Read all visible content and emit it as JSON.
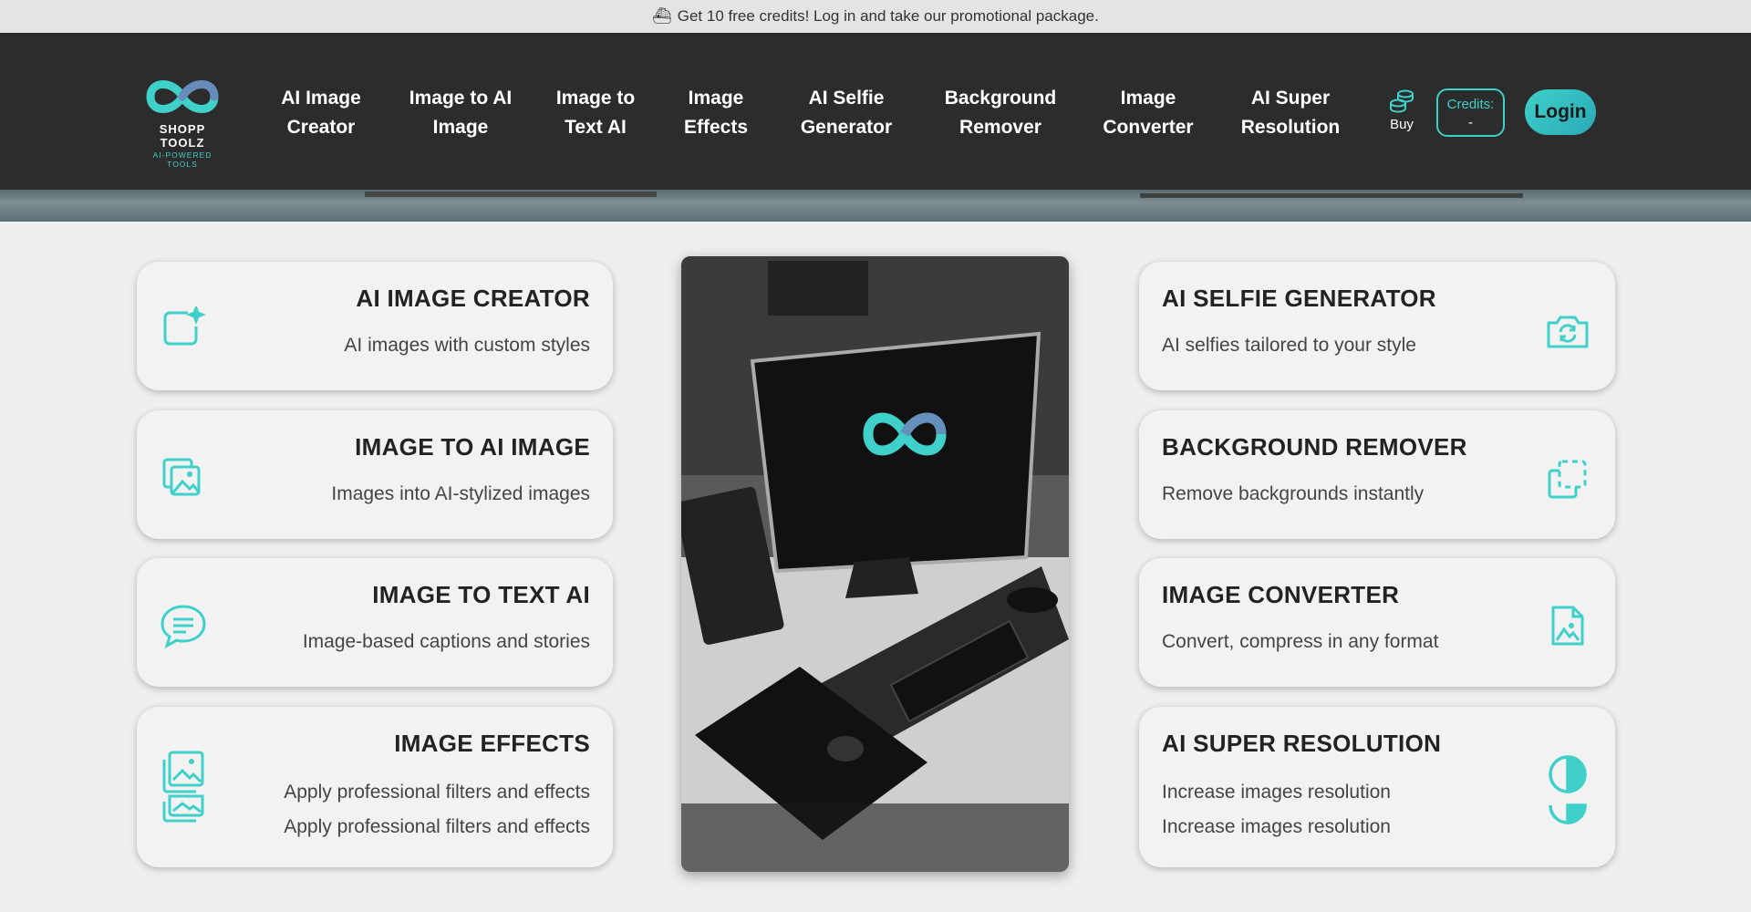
{
  "promo": {
    "icon": "ship-icon",
    "text": "Get 10 free credits! Log in and take our promotional package."
  },
  "logo": {
    "brand": "SHOPP TOOLZ",
    "tagline": "AI-POWERED TOOLS"
  },
  "nav": {
    "items": [
      {
        "line1": "AI Image",
        "line2": "Creator"
      },
      {
        "line1": "Image to AI",
        "line2": "Image"
      },
      {
        "line1": "Image to",
        "line2": "Text AI"
      },
      {
        "line1": "Image",
        "line2": "Effects"
      },
      {
        "line1": "AI Selfie",
        "line2": "Generator"
      },
      {
        "line1": "Background",
        "line2": "Remover"
      },
      {
        "line1": "Image",
        "line2": "Converter"
      },
      {
        "line1": "AI Super",
        "line2": "Resolution"
      }
    ],
    "buy_label": "Buy",
    "credits_label": "Credits:",
    "credits_value": "-",
    "login_label": "Login"
  },
  "cards": {
    "left": [
      {
        "title": "AI IMAGE CREATOR",
        "desc": "AI images with custom styles",
        "icon": "image-sparkle-icon"
      },
      {
        "title": "IMAGE TO AI IMAGE",
        "desc": "Images into AI-stylized images",
        "icon": "photo-stack-icon"
      },
      {
        "title": "IMAGE TO TEXT AI",
        "desc": "Image-based captions and stories",
        "icon": "chat-bubble-icon"
      },
      {
        "title": "IMAGE EFFECTS",
        "desc": "Apply professional filters and effects",
        "desc2": "Apply professional filters and effects",
        "icon": "gallery-icon"
      }
    ],
    "right": [
      {
        "title": "AI SELFIE GENERATOR",
        "desc": "AI selfies tailored to your style",
        "icon": "camera-rotate-icon"
      },
      {
        "title": "BACKGROUND REMOVER",
        "desc": "Remove backgrounds instantly",
        "icon": "copy-dashed-icon"
      },
      {
        "title": "IMAGE CONVERTER",
        "desc": "Convert, compress in any format",
        "icon": "file-image-icon"
      },
      {
        "title": "AI SUPER RESOLUTION",
        "desc": "Increase images resolution",
        "desc2": "Increase images resolution",
        "icon": "half-circle-icon"
      }
    ]
  },
  "colors": {
    "accent": "#3fd0c9",
    "nav_bg": "#2c2c2c"
  }
}
